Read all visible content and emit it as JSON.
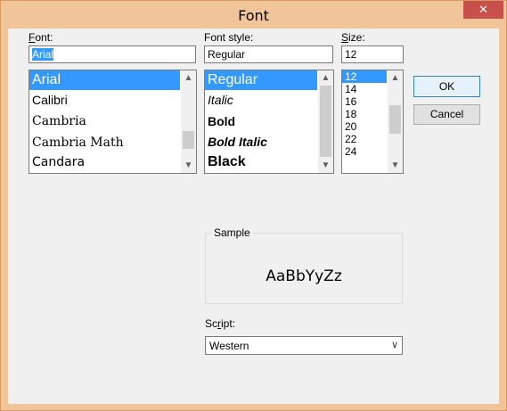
{
  "window": {
    "title": "Font",
    "close_glyph": "✕"
  },
  "font": {
    "label_key": "F",
    "label_rest": "ont:",
    "value": "Arial",
    "items": [
      "Arial",
      "Calibri",
      "Cambria",
      "Cambria Math",
      "Candara"
    ],
    "selected_index": 0
  },
  "style": {
    "label": "Font style:",
    "value": "Regular",
    "items": [
      "Regular",
      "Italic",
      "Bold",
      "Bold Italic",
      "Black"
    ],
    "selected_index": 0
  },
  "size": {
    "label_key": "S",
    "label_rest": "ize:",
    "value": "12",
    "items": [
      "12",
      "14",
      "16",
      "18",
      "20",
      "22",
      "24"
    ],
    "selected_index": 0
  },
  "buttons": {
    "ok": "OK",
    "cancel": "Cancel"
  },
  "sample": {
    "label": "Sample",
    "text": "AaBbYyZz"
  },
  "script": {
    "label_pre": "Sc",
    "label_key": "r",
    "label_rest": "ipt:",
    "value": "Western"
  },
  "colors": {
    "titlebar": "#f0c59a",
    "close": "#c7514a",
    "selection": "#3399ff",
    "dialog_bg": "#f0f0f0"
  },
  "icons": {
    "close": "close-icon",
    "scroll_up": "chevron-up-icon",
    "scroll_down": "chevron-down-icon",
    "dropdown": "chevron-down-icon"
  }
}
